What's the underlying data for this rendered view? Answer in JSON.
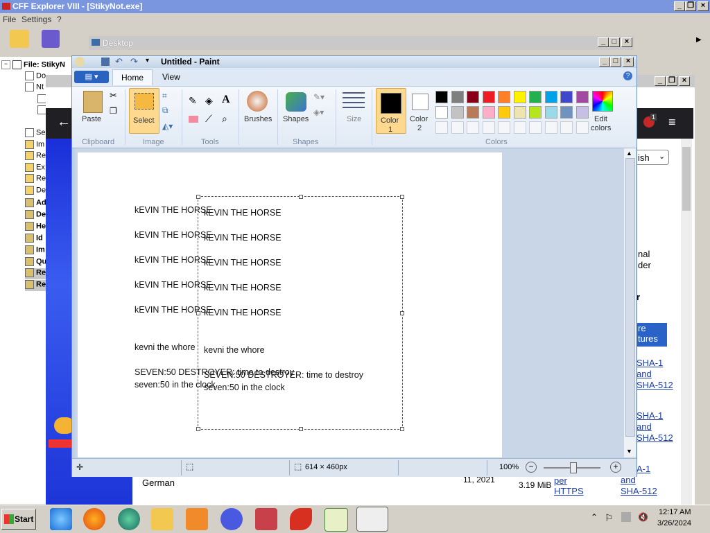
{
  "cff": {
    "title": "CFF Explorer VIII - [StikyNot.exe]",
    "menu": [
      "File",
      "Settings",
      "?"
    ],
    "tree_root": "File: StikyN",
    "tree_items": [
      "Do",
      "Nt",
      "",
      "",
      "Se",
      "Im",
      "Re",
      "Ex",
      "Re",
      "De",
      "Ad",
      "De",
      "He",
      "Id",
      "Im",
      "Qu",
      "Re",
      "Re"
    ]
  },
  "desktop_window": {
    "title": "Desktop"
  },
  "paint": {
    "title": "Untitled - Paint",
    "tabs": {
      "home": "Home",
      "view": "View"
    },
    "groups": {
      "clipboard": "Clipboard",
      "image": "Image",
      "tools": "Tools",
      "shapes": "Shapes",
      "colors": "Colors"
    },
    "buttons": {
      "paste": "Paste",
      "select": "Select",
      "brushes": "Brushes",
      "shapes": "Shapes",
      "size": "Size",
      "color1_a": "Color",
      "color1_b": "1",
      "color2_a": "Color",
      "color2_b": "2",
      "edit_colors_a": "Edit",
      "edit_colors_b": "colors"
    },
    "palette_row1": [
      "#000000",
      "#7f7f7f",
      "#880015",
      "#ed1c24",
      "#ff7f27",
      "#fff200",
      "#22b14c",
      "#00a2e8",
      "#3f48cc",
      "#a349a4"
    ],
    "palette_row2": [
      "#ffffff",
      "#c3c3c3",
      "#b97a57",
      "#ffaec9",
      "#ffc90e",
      "#efe4b0",
      "#b5e61d",
      "#99d9ea",
      "#7092be",
      "#c8bfe7"
    ],
    "canvas_text_left": [
      "kEVIN THE HORSE",
      "kEVIN THE HORSE",
      "kEVIN THE HORSE",
      "kEVIN THE HORSE",
      "kEVIN THE HORSE",
      "kevni the whore",
      "SEVEN:50 DESTROYER: time to destroy",
      "seven:50 in the clock"
    ],
    "canvas_text_sel": [
      "kEVIN THE HORSE",
      "kEVIN THE HORSE",
      "kEVIN THE HORSE",
      "kEVIN THE HORSE",
      "kEVIN THE HORSE",
      "kevni the whore",
      "SEVEN:50 DESTROYER: time to destroy",
      "seven:50 in the clock"
    ],
    "status": {
      "size": "614 × 460px",
      "zoom": "100%"
    }
  },
  "browser": {
    "lang": "ish",
    "right_text": [
      "nal",
      "der",
      "r"
    ],
    "feature_head": [
      "re",
      "tures"
    ],
    "sha_links": [
      "SHA-1",
      "and",
      "SHA-512"
    ],
    "bottom_lang": "German",
    "bottom_date": "11, 2021",
    "bottom_size": "3.19 MiB",
    "bottom_proto": [
      "per",
      "HTTPS"
    ],
    "bottom_sha": [
      "A-1",
      "and",
      "SHA-512"
    ],
    "notif_count": "1"
  },
  "taskbar": {
    "start": "Start",
    "time": "12:17 AM",
    "date": "3/26/2024"
  }
}
